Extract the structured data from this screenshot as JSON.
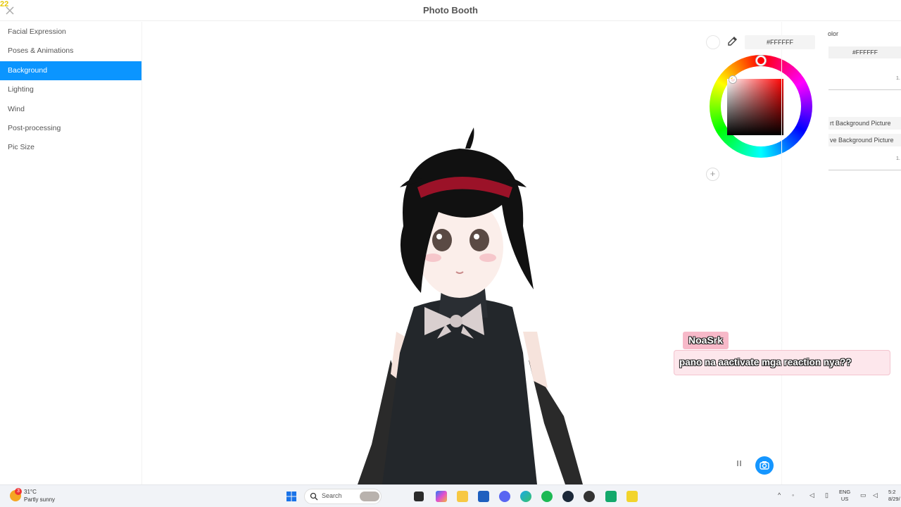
{
  "app": {
    "title": "Photo Booth",
    "corner_badge": "22",
    "close_icon": "close-icon"
  },
  "sidebar": {
    "items": [
      {
        "label": "Facial Expression",
        "active": false
      },
      {
        "label": "Poses & Animations",
        "active": false
      },
      {
        "label": "Background",
        "active": true
      },
      {
        "label": "Lighting",
        "active": false
      },
      {
        "label": "Wind",
        "active": false
      },
      {
        "label": "Post-processing",
        "active": false
      },
      {
        "label": "Pic Size",
        "active": false
      }
    ]
  },
  "color_picker": {
    "hex_value": "#FFFFFF",
    "selected_hue_color": "#ff0000",
    "add_label": "+"
  },
  "right_panel": {
    "color_label": "olor",
    "color_hex": "#FFFFFF",
    "value_1": "1.",
    "import_button": "rt Background Picture",
    "remove_button": "ve Background Picture",
    "value_2": "1."
  },
  "chat": {
    "username": "NoaSrk",
    "message": "pano na aactivate mga reaction nya??"
  },
  "controls": {
    "pause_icon": "pause-icon",
    "camera_icon": "camera-icon",
    "accent": "#1596ff"
  },
  "taskbar": {
    "weather_badge": "3",
    "temperature": "31°C",
    "weather_desc": "Partly sunny",
    "search_label": "Search",
    "lang_top": "ENG",
    "lang_bottom": "US",
    "clock_top": "5:2",
    "clock_bottom": "8/29/"
  }
}
